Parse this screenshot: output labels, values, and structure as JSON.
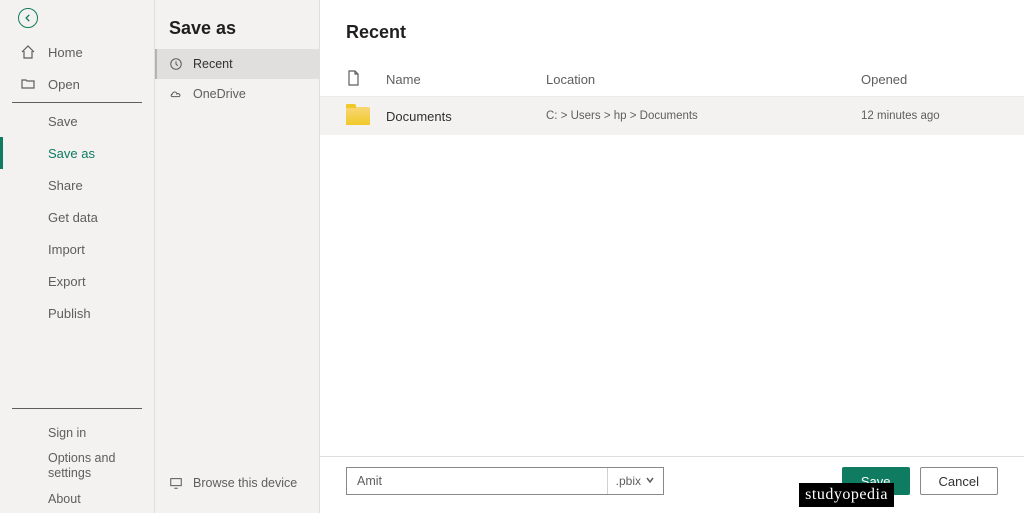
{
  "leftNav": {
    "home": "Home",
    "open": "Open",
    "save": "Save",
    "saveAs": "Save as",
    "share": "Share",
    "getData": "Get data",
    "import": "Import",
    "export": "Export",
    "publish": "Publish",
    "signIn": "Sign in",
    "options": "Options and settings",
    "about": "About"
  },
  "midCol": {
    "title": "Save as",
    "recent": "Recent",
    "onedrive": "OneDrive",
    "browse": "Browse this device"
  },
  "main": {
    "title": "Recent",
    "headers": {
      "name": "Name",
      "location": "Location",
      "opened": "Opened"
    },
    "row": {
      "name": "Documents",
      "location": "C: > Users > hp > Documents",
      "opened": "12 minutes ago"
    }
  },
  "bottom": {
    "filename": "Amit",
    "ext": ".pbix",
    "save": "Save",
    "cancel": "Cancel"
  },
  "watermark": "studyopedia"
}
